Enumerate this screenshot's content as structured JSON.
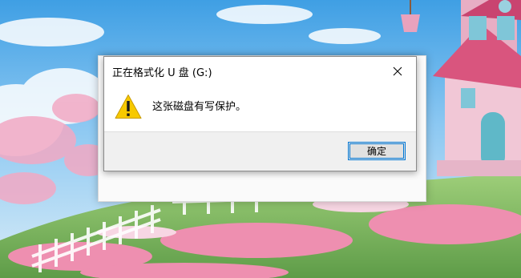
{
  "dialog": {
    "title": "正在格式化 U 盘 (G:)",
    "message": "这张磁盘有写保护。",
    "ok_label": "确定",
    "icon": "warning-icon",
    "close_icon": "close-icon"
  },
  "colors": {
    "accent": "#0078d7",
    "warning_fill": "#f7c900",
    "footer_bg": "#f0f0f0"
  }
}
